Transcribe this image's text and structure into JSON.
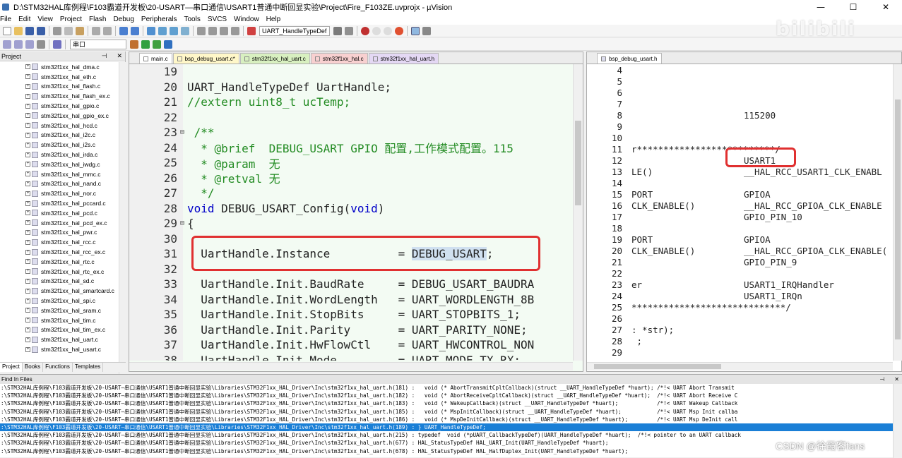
{
  "window": {
    "title": "D:\\STM32HAL库例程\\F103霸道开发板\\20-USART—串口通信\\USART1普通中断回显实验\\Project\\Fire_F103ZE.uvprojx - µVision"
  },
  "menu": [
    "File",
    "Edit",
    "View",
    "Project",
    "Flash",
    "Debug",
    "Peripherals",
    "Tools",
    "SVCS",
    "Window",
    "Help"
  ],
  "toolbar": {
    "function_combo": "UART_HandleTypeDef",
    "target_combo": "串口"
  },
  "project": {
    "header": "Project",
    "files": [
      "stm32f1xx_hal_dma.c",
      "stm32f1xx_hal_eth.c",
      "stm32f1xx_hal_flash.c",
      "stm32f1xx_hal_flash_ex.c",
      "stm32f1xx_hal_gpio.c",
      "stm32f1xx_hal_gpio_ex.c",
      "stm32f1xx_hal_hcd.c",
      "stm32f1xx_hal_i2c.c",
      "stm32f1xx_hal_i2s.c",
      "stm32f1xx_hal_irda.c",
      "stm32f1xx_hal_iwdg.c",
      "stm32f1xx_hal_mmc.c",
      "stm32f1xx_hal_nand.c",
      "stm32f1xx_hal_nor.c",
      "stm32f1xx_hal_pccard.c",
      "stm32f1xx_hal_pcd.c",
      "stm32f1xx_hal_pcd_ex.c",
      "stm32f1xx_hal_pwr.c",
      "stm32f1xx_hal_rcc.c",
      "stm32f1xx_hal_rcc_ex.c",
      "stm32f1xx_hal_rtc.c",
      "stm32f1xx_hal_rtc_ex.c",
      "stm32f1xx_hal_sd.c",
      "stm32f1xx_hal_smartcard.c",
      "stm32f1xx_hal_spi.c",
      "stm32f1xx_hal_sram.c",
      "stm32f1xx_hal_tim.c",
      "stm32f1xx_hal_tim_ex.c",
      "stm32f1xx_hal_uart.c",
      "stm32f1xx_hal_usart.c"
    ],
    "tabs": [
      "Project",
      "Books",
      "Functions",
      "Templates"
    ]
  },
  "editor": {
    "tabs": [
      {
        "label": "main.c",
        "color": "#ffffff"
      },
      {
        "label": "bsp_debug_usart.c*",
        "color": "#fff7c8"
      },
      {
        "label": "stm32f1xx_hal_uart.c",
        "color": "#d8f0c0"
      },
      {
        "label": "stm32f1xx_hal.c",
        "color": "#f8d0d0"
      },
      {
        "label": "stm32f1xx_hal_uart.h",
        "color": "#e4d8f4"
      }
    ],
    "lines": [
      {
        "n": "19",
        "t": ""
      },
      {
        "n": "20",
        "t": "UART_HandleTypeDef UartHandle;"
      },
      {
        "n": "21",
        "t": "//extern uint8_t ucTemp;"
      },
      {
        "n": "22",
        "t": ""
      },
      {
        "n": "23",
        "t": " /**"
      },
      {
        "n": "24",
        "t": "  * @brief  DEBUG_USART GPIO 配置,工作模式配置。115"
      },
      {
        "n": "25",
        "t": "  * @param  无"
      },
      {
        "n": "26",
        "t": "  * @retval 无"
      },
      {
        "n": "27",
        "t": "  */"
      },
      {
        "n": "28",
        "t": "void DEBUG_USART_Config(void)"
      },
      {
        "n": "29",
        "t": "{"
      },
      {
        "n": "30",
        "t": ""
      },
      {
        "n": "31",
        "t": "  UartHandle.Instance          = DEBUG_USART;"
      },
      {
        "n": "32",
        "t": ""
      },
      {
        "n": "33",
        "t": "  UartHandle.Init.BaudRate     = DEBUG_USART_BAUDRA"
      },
      {
        "n": "34",
        "t": "  UartHandle.Init.WordLength   = UART_WORDLENGTH_8B"
      },
      {
        "n": "35",
        "t": "  UartHandle.Init.StopBits     = UART_STOPBITS_1;"
      },
      {
        "n": "36",
        "t": "  UartHandle.Init.Parity       = UART_PARITY_NONE;"
      },
      {
        "n": "37",
        "t": "  UartHandle.Init.HwFlowCtl    = UART_HWCONTROL_NON"
      },
      {
        "n": "38",
        "t": "  UartHandle.Init.Mode         = UART_MODE_TX_RX;"
      }
    ]
  },
  "editor2": {
    "tab": "bsp_debug_usart.h",
    "lines": [
      {
        "n": "4",
        "c": "",
        "v": ""
      },
      {
        "n": "5",
        "c": "",
        "v": ""
      },
      {
        "n": "6",
        "c": "",
        "v": ""
      },
      {
        "n": "7",
        "c": "",
        "v": ""
      },
      {
        "n": "8",
        "c": "",
        "v": "115200"
      },
      {
        "n": "9",
        "c": "",
        "v": ""
      },
      {
        "n": "10",
        "c": "",
        "v": ""
      },
      {
        "n": "11",
        "c": "r**************************/",
        "v": ""
      },
      {
        "n": "12",
        "c": "",
        "v": "USART1"
      },
      {
        "n": "13",
        "c": "LE()",
        "v": "__HAL_RCC_USART1_CLK_ENABL"
      },
      {
        "n": "14",
        "c": "",
        "v": ""
      },
      {
        "n": "15",
        "c": "PORT",
        "v": "GPIOA"
      },
      {
        "n": "16",
        "c": "CLK_ENABLE()",
        "v": "__HAL_RCC_GPIOA_CLK_ENABLE"
      },
      {
        "n": "17",
        "c": "",
        "v": "GPIO_PIN_10"
      },
      {
        "n": "18",
        "c": "",
        "v": ""
      },
      {
        "n": "19",
        "c": "PORT",
        "v": "GPIOA"
      },
      {
        "n": "20",
        "c": "CLK_ENABLE()",
        "v": "__HAL_RCC_GPIOA_CLK_ENABLE("
      },
      {
        "n": "21",
        "c": "",
        "v": "GPIO_PIN_9"
      },
      {
        "n": "22",
        "c": "",
        "v": ""
      },
      {
        "n": "23",
        "c": "er",
        "v": "USART1_IRQHandler"
      },
      {
        "n": "24",
        "c": "",
        "v": "USART1_IRQn"
      },
      {
        "n": "25",
        "c": "*****************************/",
        "v": ""
      },
      {
        "n": "26",
        "c": "",
        "v": ""
      },
      {
        "n": "27",
        "c": ": *str);",
        "v": ""
      },
      {
        "n": "28",
        "c": " ;",
        "v": ""
      },
      {
        "n": "29",
        "c": "",
        "v": ""
      }
    ]
  },
  "find": {
    "header": "Find In Files",
    "results": [
      ":\\STM32HAL库例程\\F103霸道开发板\\20-USART—串口通信\\USART1普通中断回显实验\\Libraries\\STM32F1xx_HAL_Driver\\Inc\\stm32f1xx_hal_uart.h(181) :   void (* AbortTransmitCpltCallback)(struct __UART_HandleTypeDef *huart); /*!< UART Abort Transmit",
      ":\\STM32HAL库例程\\F103霸道开发板\\20-USART—串口通信\\USART1普通中断回显实验\\Libraries\\STM32F1xx_HAL_Driver\\Inc\\stm32f1xx_hal_uart.h(182) :   void (* AbortReceiveCpltCallback)(struct __UART_HandleTypeDef *huart);  /*!< UART Abort Receive C",
      ":\\STM32HAL库例程\\F103霸道开发板\\20-USART—串口通信\\USART1普通中断回显实验\\Libraries\\STM32F1xx_HAL_Driver\\Inc\\stm32f1xx_hal_uart.h(183) :   void (* WakeupCallback)(struct __UART_HandleTypeDef *huart);            /*!< UART Wakeup Callback",
      ":\\STM32HAL库例程\\F103霸道开发板\\20-USART—串口通信\\USART1普通中断回显实验\\Libraries\\STM32F1xx_HAL_Driver\\Inc\\stm32f1xx_hal_uart.h(185) :   void (* MspInitCallback)(struct __UART_HandleTypeDef *huart);           /*!< UART Msp Init callba",
      ":\\STM32HAL库例程\\F103霸道开发板\\20-USART—串口通信\\USART1普通中断回显实验\\Libraries\\STM32F1xx_HAL_Driver\\Inc\\stm32f1xx_hal_uart.h(186) :   void (* MspDeInitCallback)(struct __UART_HandleTypeDef *huart);         /*!< UART Msp DeInit call",
      ":\\STM32HAL库例程\\F103霸道开发板\\20-USART—串口通信\\USART1普通中断回显实验\\Libraries\\STM32F1xx_HAL_Driver\\Inc\\stm32f1xx_hal_uart.h(189) : } UART_HandleTypeDef;",
      ":\\STM32HAL库例程\\F103霸道开发板\\20-USART—串口通信\\USART1普通中断回显实验\\Libraries\\STM32F1xx_HAL_Driver\\Inc\\stm32f1xx_hal_uart.h(215) : typedef  void (*pUART_CallbackTypeDef)(UART_HandleTypeDef *huart);  /*!< pointer to an UART callback",
      ":\\STM32HAL库例程\\F103霸道开发板\\20-USART—串口通信\\USART1普通中断回显实验\\Libraries\\STM32F1xx_HAL_Driver\\Inc\\stm32f1xx_hal_uart.h(677) : HAL_StatusTypeDef HAL_UART_Init(UART_HandleTypeDef *huart);",
      ":\\STM32HAL库例程\\F103霸道开发板\\20-USART—串口通信\\USART1普通中断回显实验\\Libraries\\STM32F1xx_HAL_Driver\\Inc\\stm32f1xx_hal_uart.h(678) : HAL_StatusTypeDef HAL_HalfDuplex_Init(UART_HandleTypeDef *huart);"
    ],
    "highlight_index": 5
  },
  "watermarks": {
    "bilibili": "bilibili",
    "csdn": "CSDN @徐霞客fans"
  }
}
